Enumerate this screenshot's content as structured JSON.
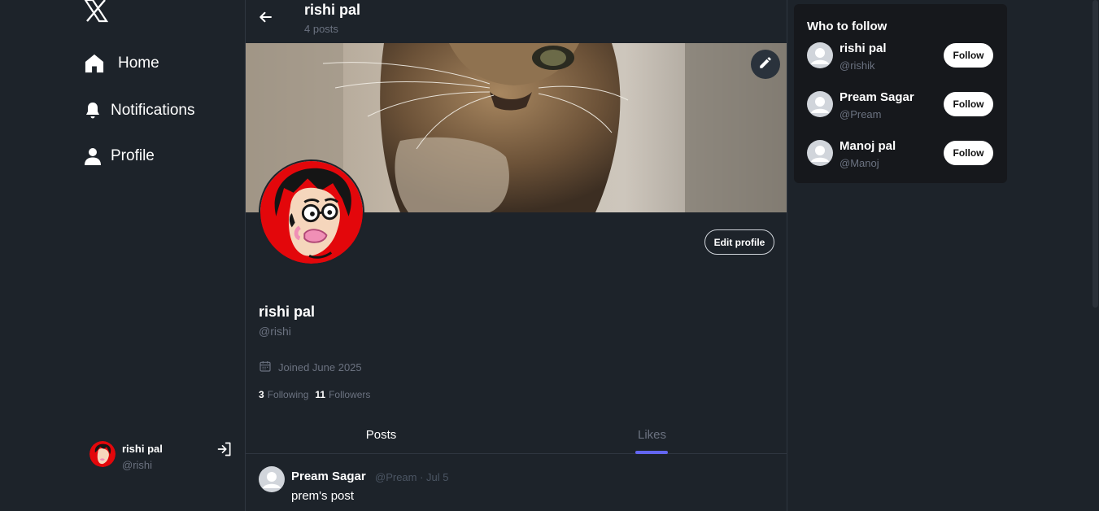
{
  "nav": {
    "items": [
      {
        "label": "Home",
        "icon": "home-icon"
      },
      {
        "label": "Notifications",
        "icon": "bell-icon"
      },
      {
        "label": "Profile",
        "icon": "user-icon"
      }
    ]
  },
  "current_user": {
    "name": "rishi pal",
    "handle": "@rishi"
  },
  "header": {
    "title": "rishi pal",
    "post_count": "4 posts"
  },
  "profile": {
    "name": "rishi pal",
    "handle": "@rishi",
    "joined": "Joined June 2025",
    "following_count": "3",
    "following_label": "Following",
    "followers_count": "11",
    "followers_label": "Followers",
    "edit_label": "Edit profile"
  },
  "tabs": [
    {
      "label": "Posts",
      "active": false
    },
    {
      "label": "Likes",
      "active": true
    }
  ],
  "posts": [
    {
      "author": "Pream Sagar",
      "meta": "@Pream · Jul 5",
      "text": "prem's post"
    }
  ],
  "who_to_follow": {
    "title": "Who to follow",
    "users": [
      {
        "name": "rishi pal",
        "handle": "@rishik",
        "button": "Follow"
      },
      {
        "name": "Pream Sagar",
        "handle": "@Pream",
        "button": "Follow"
      },
      {
        "name": "Manoj pal",
        "handle": "@Manoj",
        "button": "Follow"
      }
    ]
  },
  "colors": {
    "background": "#1d232a",
    "panel": "#16181c",
    "accent": "#6366f1",
    "text_primary": "#ffffff",
    "text_muted": "#6b7280"
  }
}
